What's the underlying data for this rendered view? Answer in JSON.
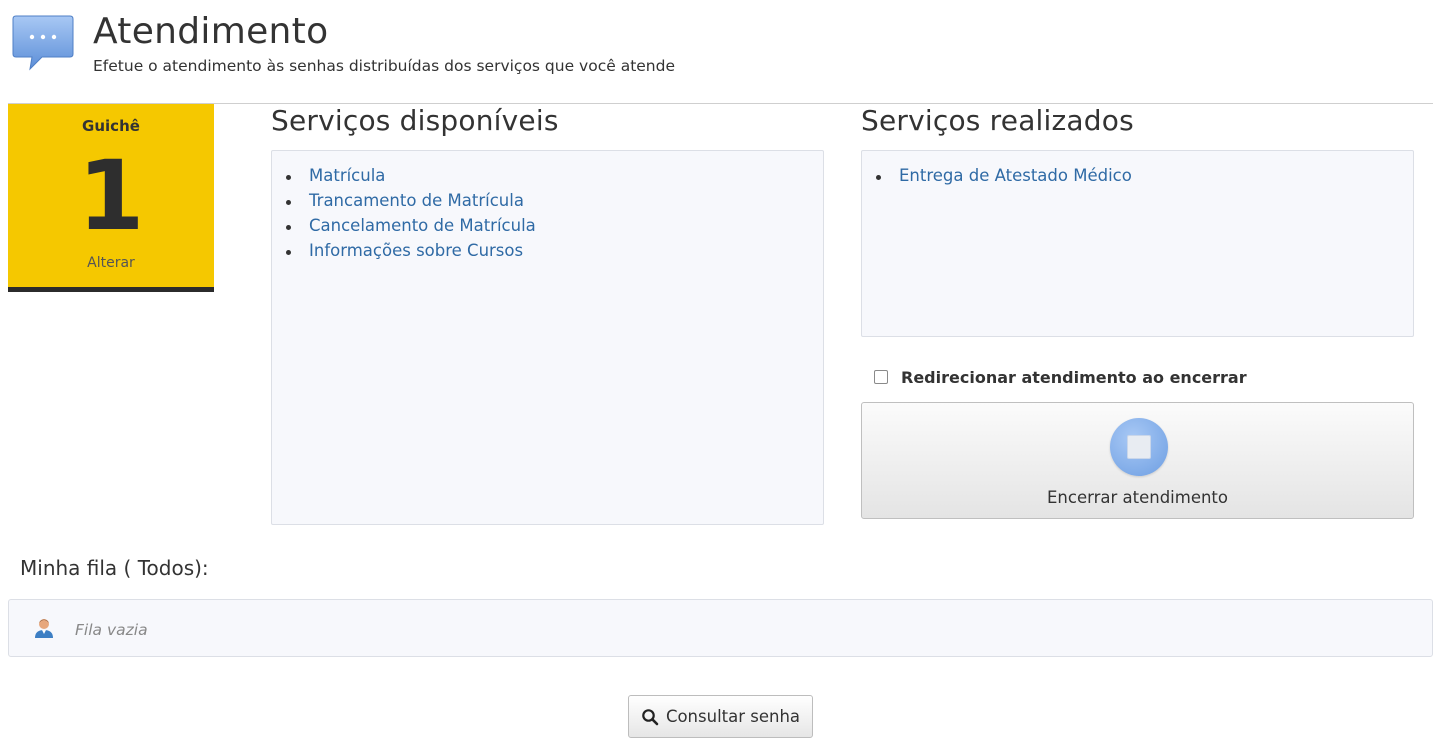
{
  "header": {
    "title": "Atendimento",
    "subtitle": "Efetue o atendimento às senhas distribuídas dos serviços que você atende",
    "icon": "chat-bubble-icon"
  },
  "guiche": {
    "label": "Guichê",
    "number": "1",
    "change_label": "Alterar",
    "color": "#f5c800"
  },
  "available_services": {
    "title": "Serviços disponíveis",
    "items": [
      {
        "label": "Matrícula"
      },
      {
        "label": "Trancamento de Matrícula"
      },
      {
        "label": "Cancelamento de Matrícula"
      },
      {
        "label": "Informações sobre Cursos"
      }
    ]
  },
  "performed_services": {
    "title": "Serviços realizados",
    "items": [
      {
        "label": "Entrega de Atestado Médico"
      }
    ]
  },
  "redirect": {
    "label": "Redirecionar atendimento ao encerrar",
    "checked": false
  },
  "end_button": {
    "label": "Encerrar atendimento",
    "icon": "stop-icon"
  },
  "queue": {
    "title": "Minha fila ( Todos):",
    "empty_text": "Fila vazia",
    "icon": "user-icon"
  },
  "consult_button": {
    "label": "Consultar senha",
    "icon": "search-icon"
  },
  "colors": {
    "link": "#2f6aa5",
    "panel_bg": "#f7f8fc"
  }
}
